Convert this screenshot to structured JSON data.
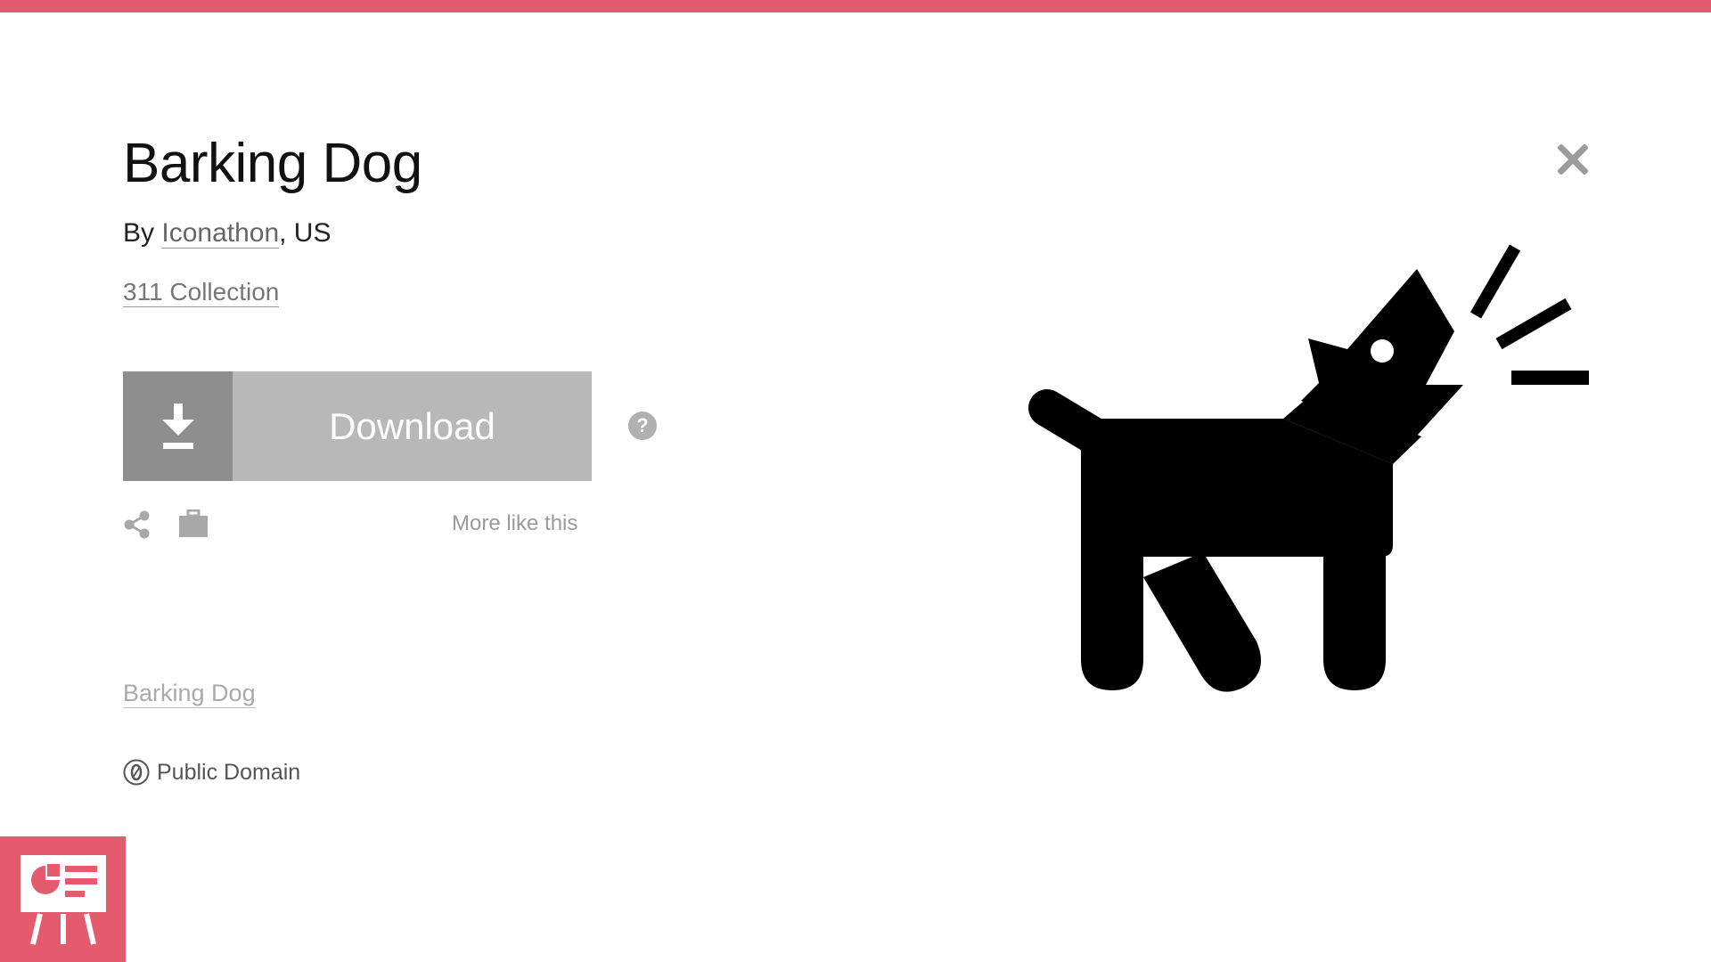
{
  "accent_color": "#e35b6c",
  "icon": {
    "title": "Barking Dog",
    "by_prefix": "By ",
    "author": "Iconathon",
    "location_suffix": ", US",
    "collection": "311 Collection",
    "tag": "Barking Dog",
    "license": "Public Domain"
  },
  "actions": {
    "download_label": "Download",
    "more_like_this": "More like this"
  },
  "icons": {
    "download": "download-icon",
    "help": "help-icon",
    "share": "share-icon",
    "kit": "briefcase-icon",
    "close": "close-icon",
    "license": "cc0-icon",
    "badge": "presentation-icon"
  }
}
